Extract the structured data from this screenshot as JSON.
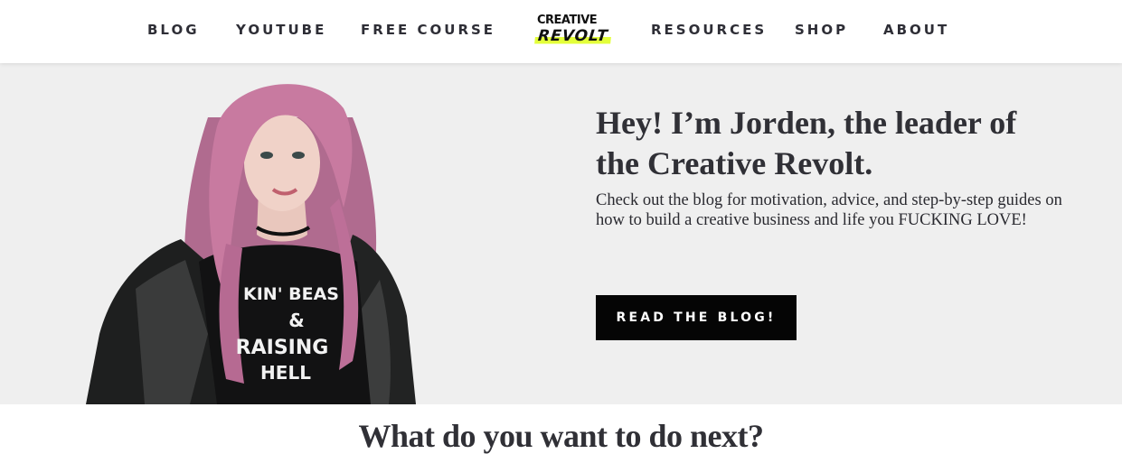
{
  "nav": {
    "items": [
      {
        "label": "BLOG"
      },
      {
        "label": "YOUTUBE"
      },
      {
        "label": "FREE COURSE"
      },
      {
        "label": "RESOURCES"
      },
      {
        "label": "SHOP"
      },
      {
        "label": "ABOUT"
      }
    ],
    "logo": {
      "line1": "CREATIVE",
      "line2": "REVOLT",
      "highlight_color": "#e3ff3a"
    }
  },
  "hero": {
    "title": "Hey! I’m Jorden, the leader of the Creative Revolt.",
    "text": "Check out the blog for motivation, advice, and step-by-step guides on how to build a creative business and life you FUCKING LOVE!",
    "button_label": "READ THE BLOG!",
    "photo": {
      "shirt_line1": "KIN' BEAS",
      "shirt_line2": "&",
      "shirt_line3": "RAISING",
      "shirt_line4": "HELL",
      "hair_color": "#c87aa0"
    },
    "background": "#efefef"
  },
  "next": {
    "heading": "What do you want to do next?"
  }
}
